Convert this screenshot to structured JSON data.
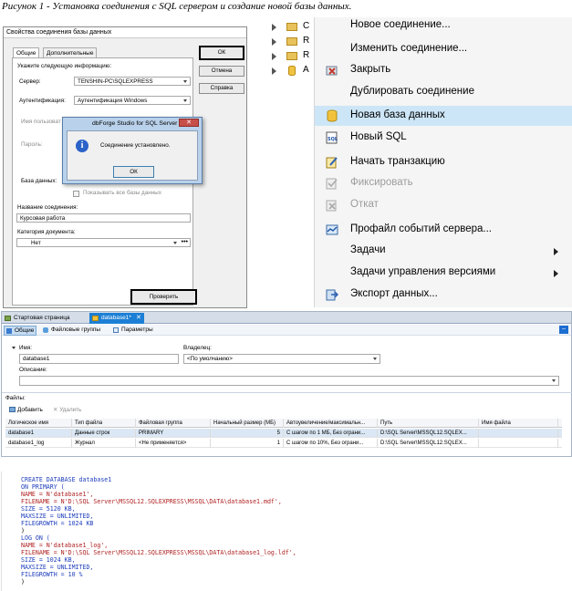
{
  "caption": "Рисунок 1 - Установка соединения с SQL сервером и создание новой базы данных.",
  "dialog": {
    "title": "Свойства соединения базы данных",
    "tabs": [
      "Общие",
      "Дополнительные"
    ],
    "instruction": "Укажите следующую информацию:",
    "server_label": "Сервер:",
    "server_value": "TENSHIN-PC\\SQLEXPRESS",
    "auth_label": "Аутентификация:",
    "auth_value": "Аутентификация Windows",
    "user_label": "Имя пользоват",
    "password_label": "Пароль:",
    "database_label": "База данных:",
    "show_all_dbs": "Показывать все базы данных",
    "conn_name_label": "Название соединения:",
    "conn_name_value": "Курсовая работа",
    "doc_category_label": "Категория документа:",
    "doc_category_value": "Нет",
    "ok": "ОК",
    "cancel": "Отмена",
    "help": "Справка",
    "test": "Проверить"
  },
  "msgbox": {
    "title": "dbForge Studio for SQL Server",
    "close": "✕",
    "text": "Соединение установлено.",
    "ok": "ОК"
  },
  "tree": [
    "С",
    "R",
    "R",
    "A"
  ],
  "context_menu": {
    "items": [
      {
        "label": "Новое соединение...",
        "icon": "",
        "disabled": false,
        "selected": false,
        "submenu": false
      },
      {
        "label": "Изменить соединение...",
        "icon": "",
        "disabled": false,
        "selected": false,
        "submenu": false
      },
      {
        "label": "Закрыть",
        "icon": "close-icon",
        "disabled": false,
        "selected": false,
        "submenu": false
      },
      {
        "label": "Дублировать соединение",
        "icon": "",
        "disabled": false,
        "selected": false,
        "submenu": false
      },
      {
        "label": "Новая база данных",
        "icon": "database-icon",
        "disabled": false,
        "selected": true,
        "submenu": false
      },
      {
        "label": "Новый SQL",
        "icon": "sql-icon",
        "disabled": false,
        "selected": false,
        "submenu": false
      },
      {
        "label": "Начать транзакцию",
        "icon": "transaction-icon",
        "disabled": false,
        "selected": false,
        "submenu": false
      },
      {
        "label": "Фиксировать",
        "icon": "commit-icon",
        "disabled": true,
        "selected": false,
        "submenu": false
      },
      {
        "label": "Откат",
        "icon": "rollback-icon",
        "disabled": true,
        "selected": false,
        "submenu": false
      },
      {
        "label": "Профайл событий сервера...",
        "icon": "profiler-icon",
        "disabled": false,
        "selected": false,
        "submenu": false
      },
      {
        "label": "Задачи",
        "icon": "",
        "disabled": false,
        "selected": false,
        "submenu": true
      },
      {
        "label": "Задачи управления версиями",
        "icon": "",
        "disabled": false,
        "selected": false,
        "submenu": true
      },
      {
        "label": "Экспорт данных...",
        "icon": "export-icon",
        "disabled": false,
        "selected": false,
        "submenu": false
      }
    ]
  },
  "editor": {
    "tabs": [
      "Стартовая страница",
      "database1*"
    ],
    "tab_close": "✕",
    "toolbar": [
      "Общие",
      "Файловые группы",
      "Параметры"
    ],
    "name_label": "Имя:",
    "name_value": "database1",
    "owner_label": "Владелец:",
    "owner_value": "<По умолчанию>",
    "description_label": "Описание:",
    "files_label": "Файлы:",
    "add_label": "Добавить",
    "delete_label": "Удалить",
    "columns": [
      "Логическое имя",
      "Тип файла",
      "Файловая группа",
      "Начальный размер (МБ)",
      "Автоувеличение/максимальн...",
      "Путь",
      "Имя файла"
    ],
    "rows": [
      [
        "database1",
        "Данные строк",
        "PRIMARY",
        "5",
        "С шагом по 1 МБ, Без ограни...",
        "D:\\SQL Server\\MSSQL12.SQLEX...",
        ""
      ],
      [
        "database1_log",
        "Журнал",
        "<Не применяется>",
        "1",
        "С шагом по 10%, Без ограни...",
        "D:\\SQL Server\\MSSQL12.SQLEX...",
        ""
      ]
    ]
  },
  "code": [
    "CREATE DATABASE database1",
    "ON PRIMARY (",
    "NAME = N'database1',",
    "FILENAME = N'D:\\SQL Server\\MSSQL12.SQLEXPRESS\\MSSQL\\DATA\\database1.mdf',",
    "SIZE = 5120 KB,",
    "MAXSIZE = UNLIMITED,",
    "FILEGROWTH = 1024 KB",
    ")",
    "LOG ON (",
    "NAME = N'database1_log',",
    "FILENAME = N'D:\\SQL Server\\MSSQL12.SQLEXPRESS\\MSSQL\\DATA\\database1_log.ldf',",
    "SIZE = 1024 KB,",
    "MAXSIZE = UNLIMITED,",
    "FILEGROWTH = 10 %",
    ")"
  ]
}
